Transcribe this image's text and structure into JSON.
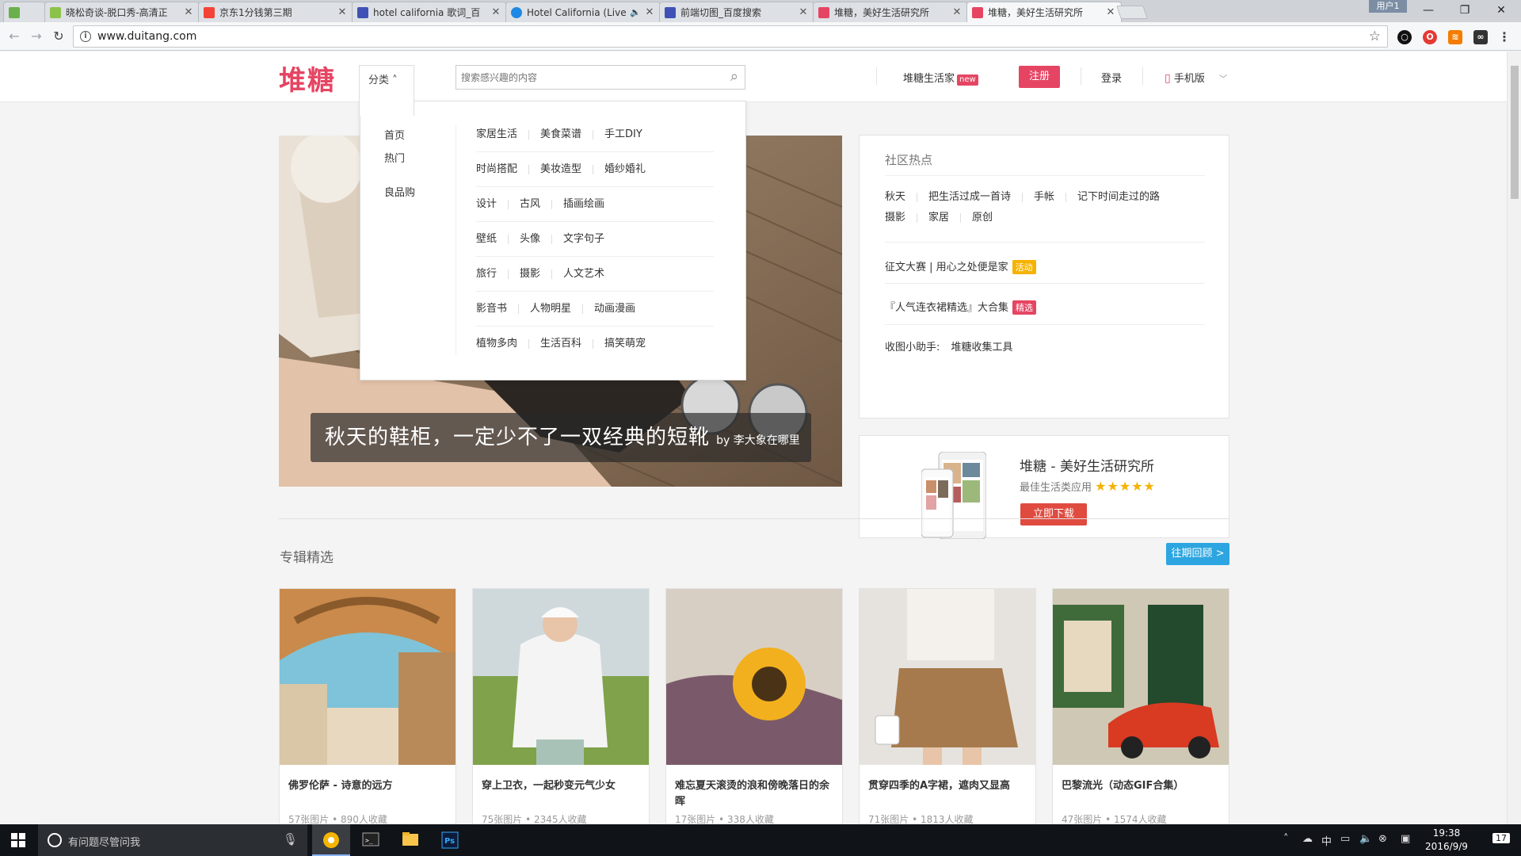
{
  "browser": {
    "tabs": [
      {
        "title": "",
        "color": "#6ab04c",
        "active": false
      },
      {
        "title": "晓松奇谈-脱口秀-高清正",
        "color": "#8bc34a",
        "active": false
      },
      {
        "title": "京东1分钱第三期",
        "color": "#f44336",
        "active": false
      },
      {
        "title": "hotel california 歌词_百",
        "color": "#3f51b5",
        "active": false
      },
      {
        "title": "Hotel California (Live",
        "color": "#1e88e5",
        "active": false
      },
      {
        "title": "前端切图_百度搜索",
        "color": "#3f51b5",
        "active": false
      },
      {
        "title": "堆糖，美好生活研究所",
        "color": "#e54563",
        "active": false
      },
      {
        "title": "堆糖，美好生活研究所",
        "color": "#e54563",
        "active": true
      }
    ],
    "user_badge": "用户1",
    "window_controls": {
      "minimize": "—",
      "maximize": "❐",
      "close": "✕"
    },
    "url": "www.duitang.com"
  },
  "site": {
    "logo": "堆糖",
    "category_button": "分类 ˄",
    "search_placeholder": "搜索感兴趣的内容",
    "nav": {
      "home_label": "堆糖生活家",
      "new_badge": "new",
      "register": "注册",
      "login": "登录",
      "mobile": "手机版"
    },
    "dropdown": {
      "left": [
        "首页",
        "热门",
        "良品购"
      ],
      "rows": [
        [
          "家居生活",
          "美食菜谱",
          "手工DIY"
        ],
        [
          "时尚搭配",
          "美妆造型",
          "婚纱婚礼"
        ],
        [
          "设计",
          "古风",
          "插画绘画"
        ],
        [
          "壁纸",
          "头像",
          "文字句子"
        ],
        [
          "旅行",
          "摄影",
          "人文艺术"
        ],
        [
          "影音书",
          "人物明星",
          "动画漫画"
        ],
        [
          "植物多肉",
          "生活百科",
          "搞笑萌宠"
        ]
      ]
    },
    "hero": {
      "title": "秋天的鞋柜，一定少不了一双经典的短靴",
      "byline": "by 李大象在哪里"
    },
    "community": {
      "title": "社区热点",
      "tags": [
        "秋天",
        "把生活过成一首诗",
        "手帐",
        "记下时间走过的路",
        "摄影",
        "家居",
        "原创"
      ],
      "item1": "征文大赛 | 用心之处便是家",
      "item1_badge": "活动",
      "item2": "『人气连衣裙精选』大合集",
      "item2_badge": "精选",
      "item3_label": "收图小助手:",
      "item3_link": "堆糖收集工具"
    },
    "app": {
      "title": "堆糖 - 美好生活研究所",
      "subtitle": "最佳生活类应用",
      "stars": "★★★★★",
      "download": "立即下载"
    },
    "albums": {
      "section_title": "专辑精选",
      "more": "往期回顾 >",
      "cards": [
        {
          "title": "佛罗伦萨 - 诗意的远方",
          "meta": "57张图片 • 890人收藏"
        },
        {
          "title": "穿上卫衣，一起秒变元气少女",
          "meta": "75张图片 • 2345人收藏"
        },
        {
          "title": "难忘夏天滚烫的浪和傍晚落日的余晖",
          "meta": "17张图片 • 338人收藏"
        },
        {
          "title": "贯穿四季的A字裙，遮肉又显高",
          "meta": "71张图片 • 1813人收藏"
        },
        {
          "title": "巴黎流光（动态GIF合集）",
          "meta": "47张图片 • 1574人收藏"
        }
      ]
    }
  },
  "taskbar": {
    "search_placeholder": "有问题尽管问我",
    "time": "19:38",
    "date": "2016/9/9",
    "ime": "中",
    "notifications": "17"
  },
  "colors": {
    "brand": "#e54563",
    "accent_blue": "#2da5e0",
    "download_red": "#e04b3f",
    "star": "#f6b200"
  }
}
